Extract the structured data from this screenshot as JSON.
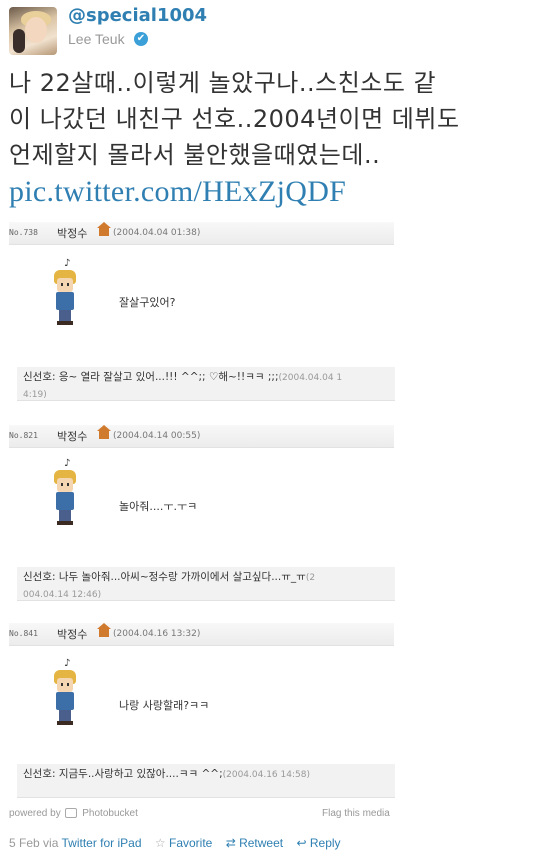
{
  "user": {
    "handle": "@special1004",
    "name": "Lee Teuk",
    "verified_glyph": "✔"
  },
  "tweet": {
    "lines": [
      "나 22살때..이렇게 놀았구나..스친소도 같",
      "이 나갔던 내친구 선호..2004년이면 데뷔도",
      "언제할지 몰라서 불안했을때였는데.."
    ],
    "link": "pic.twitter.com/HExZjQDF"
  },
  "media": {
    "entries": [
      {
        "no": "No.738",
        "author": "박정수",
        "date": "(2004.04.04 01:38)",
        "speech": "잘살구있어?",
        "reply": "신선호: 응~ 열라 잘살고 있어...!!! ^^;; ♡해~!!ㅋㅋ ;;;",
        "reply_date1": "(2004.04.04 1",
        "reply_date2": "4:19)"
      },
      {
        "no": "No.821",
        "author": "박정수",
        "date": "(2004.04.14 00:55)",
        "speech": "놀아줘....ㅜ.ㅜㅋ",
        "reply": "신선호: 나두 놀아줘...아씨~정수랑 가까이에서 살고싶다...ㅠ_ㅠ",
        "reply_date1": "(2",
        "reply_date2": "004.04.14 12:46)"
      },
      {
        "no": "No.841",
        "author": "박정수",
        "date": "(2004.04.16 13:32)",
        "speech": "나랑 사랑할래?ㅋㅋ",
        "reply": "신선호: 지금두..사랑하고 있잖아....ㅋㅋ ^^;",
        "reply_date1": "(2004.04.16 14:58)",
        "reply_date2": ""
      }
    ],
    "powered_by": "powered by",
    "provider": "Photobucket",
    "flag": "Flag this media"
  },
  "footer": {
    "date": "5 Feb",
    "via": "via",
    "client": "Twitter for iPad",
    "favorite": "Favorite",
    "retweet": "Retweet",
    "reply": "Reply"
  },
  "icons": [
    "verified-icon",
    "photobucket-icon",
    "star-icon",
    "retweet-icon",
    "reply-icon",
    "house-icon"
  ],
  "colors": {
    "link": "#2f7fb2",
    "muted": "#999999",
    "verified": "#3b9fd8"
  }
}
